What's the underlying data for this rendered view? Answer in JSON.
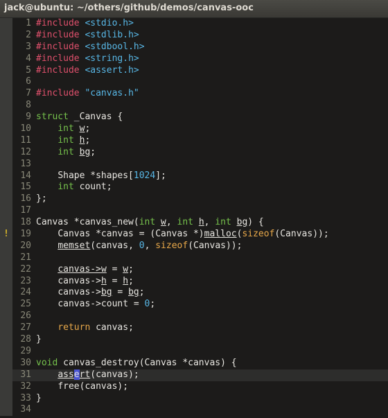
{
  "window": {
    "title": "jack@ubuntu: ~/others/github/demos/canvas-ooc"
  },
  "editor": {
    "lines": [
      {
        "n": "1"
      },
      {
        "n": "2"
      },
      {
        "n": "3"
      },
      {
        "n": "4"
      },
      {
        "n": "5"
      },
      {
        "n": "6"
      },
      {
        "n": "7"
      },
      {
        "n": "8"
      },
      {
        "n": "9"
      },
      {
        "n": "10"
      },
      {
        "n": "11"
      },
      {
        "n": "12"
      },
      {
        "n": "13"
      },
      {
        "n": "14"
      },
      {
        "n": "15"
      },
      {
        "n": "16"
      },
      {
        "n": "17"
      },
      {
        "n": "18"
      },
      {
        "n": "19",
        "sign": "!"
      },
      {
        "n": "20"
      },
      {
        "n": "21"
      },
      {
        "n": "22"
      },
      {
        "n": "23"
      },
      {
        "n": "24"
      },
      {
        "n": "25"
      },
      {
        "n": "26"
      },
      {
        "n": "27"
      },
      {
        "n": "28"
      },
      {
        "n": "29"
      },
      {
        "n": "30"
      },
      {
        "n": "31"
      },
      {
        "n": "32"
      },
      {
        "n": "33"
      },
      {
        "n": "34"
      }
    ],
    "t": {
      "inc": "#include",
      "stdio": "<stdio.h>",
      "stdlib": "<stdlib.h>",
      "stdbool": "<stdbool.h>",
      "string": "<string.h>",
      "assert": "<assert.h>",
      "canvas_h": "\"canvas.h\"",
      "struct": "struct",
      "struct_name": " _Canvas {",
      "int": "int",
      "w": "w",
      "h": "h",
      "bg": "bg",
      "semi": ";",
      "shape_decl": "Shape *shapes[",
      "n1024": "1024",
      "shape_end": "];",
      "count_decl": " count;",
      "close_struct": "};",
      "fn_head": "Canvas *canvas_new(",
      "comma_sp": ", ",
      "fn_tail": ") {",
      "l19a": "Canvas *canvas = (Canvas *)",
      "malloc": "malloc",
      "paren_open": "(",
      "sizeof": "sizeof",
      "l19b": "(Canvas));",
      "memset": "memset",
      "l20a": "(canvas, ",
      "zero": "0",
      "l20b": ", ",
      "l20c": "(Canvas));",
      "canvas_arrow": "canvas->",
      "eq": " = ",
      "count_assign": "canvas->count = ",
      "ret": "return",
      "ret_rest": " canvas;",
      "close_brace": "}",
      "void": "void",
      "destroy": " canvas_destroy(Canvas *canvas) {",
      "ass": "ass",
      "cur_e": "e",
      "rt": "rt",
      "assert_rest": "(canvas);",
      "free_call": "free(canvas);"
    }
  }
}
